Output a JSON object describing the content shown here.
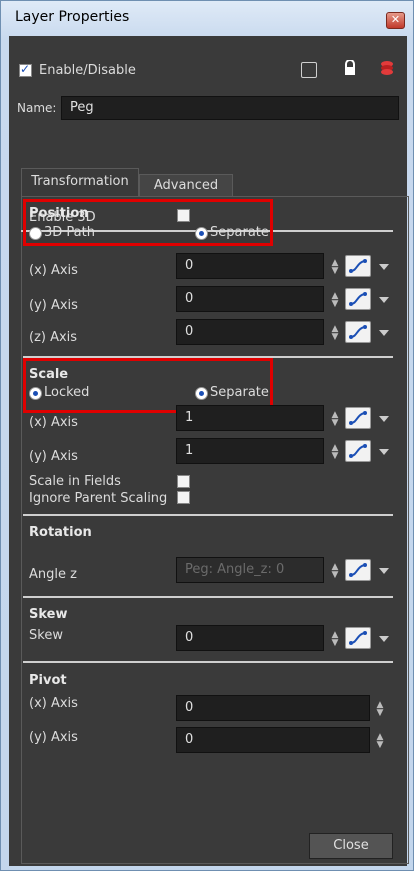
{
  "window": {
    "title": "Layer Properties"
  },
  "enable": {
    "label": "Enable/Disable",
    "checked": true
  },
  "name": {
    "label": "Name:",
    "value": "Peg"
  },
  "tabs": [
    {
      "label": "Transformation"
    },
    {
      "label": "Advanced"
    }
  ],
  "enable3d": {
    "label": "Enable 3D"
  },
  "position": {
    "heading": "Position",
    "radio_3dpath": "3D Path",
    "radio_separate": "Separate",
    "x": {
      "label": "(x) Axis",
      "value": "0"
    },
    "y": {
      "label": "(y) Axis",
      "value": "0"
    },
    "z": {
      "label": "(z) Axis",
      "value": "0"
    }
  },
  "scale": {
    "heading": "Scale",
    "radio_locked": "Locked",
    "radio_separate": "Separate",
    "x": {
      "label": "(x) Axis",
      "value": "1"
    },
    "y": {
      "label": "(y) Axis",
      "value": "1"
    },
    "scale_in_fields": "Scale in Fields",
    "ignore_parent": "Ignore Parent Scaling"
  },
  "rotation": {
    "heading": "Rotation",
    "angle_label": "Angle z",
    "angle_value": "Peg: Angle_z: 0"
  },
  "skew": {
    "heading": "Skew",
    "label": "Skew",
    "value": "0"
  },
  "pivot": {
    "heading": "Pivot",
    "x": {
      "label": "(x) Axis",
      "value": "0"
    },
    "y": {
      "label": "(y) Axis",
      "value": "0"
    }
  },
  "footer": {
    "close_label": "Close"
  },
  "icons": [
    "close-window-icon",
    "color-swatch-icon",
    "lock-icon",
    "layer-stack-icon",
    "function-curve-icon",
    "spin-arrows-icon",
    "dropdown-arrow-icon"
  ],
  "colors": {
    "panel": "#3a3a3a",
    "highlight": "#e00000",
    "accent": "#1b4fb5"
  }
}
